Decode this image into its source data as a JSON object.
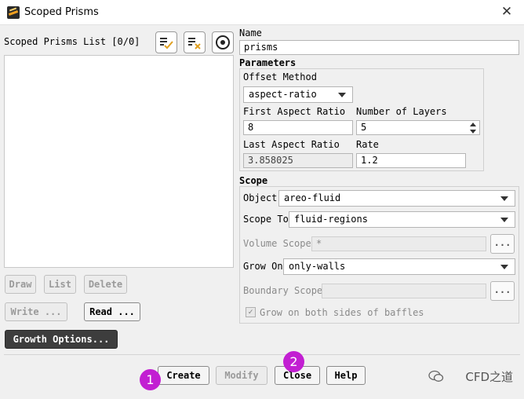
{
  "window": {
    "title": "Scoped Prisms"
  },
  "list": {
    "label": "Scoped Prisms List [0/0]",
    "items": []
  },
  "list_buttons": {
    "draw": "Draw",
    "list": "List",
    "delete": "Delete",
    "write": "Write ...",
    "read": "Read ...",
    "growth": "Growth Options..."
  },
  "name": {
    "label": "Name",
    "value": "prisms"
  },
  "parameters": {
    "heading": "Parameters",
    "offset_method_label": "Offset Method",
    "offset_method_value": "aspect-ratio",
    "first_aspect_label": "First Aspect Ratio",
    "first_aspect_value": "8",
    "layers_label": "Number of Layers",
    "layers_value": "5",
    "last_aspect_label": "Last Aspect Ratio",
    "last_aspect_value": "3.858025",
    "rate_label": "Rate",
    "rate_value": "1.2"
  },
  "scope": {
    "heading": "Scope",
    "object_label": "Object",
    "object_value": "areo-fluid",
    "scope_to_label": "Scope To",
    "scope_to_value": "fluid-regions",
    "volume_scope_label": "Volume Scope",
    "volume_scope_value": "*",
    "grow_on_label": "Grow On",
    "grow_on_value": "only-walls",
    "boundary_scope_label": "Boundary Scope",
    "boundary_scope_value": "",
    "baffles_label": "Grow on both sides of baffles",
    "baffles_checked": true,
    "dots": "..."
  },
  "footer": {
    "create": "Create",
    "modify": "Modify",
    "close": "Close",
    "help": "Help"
  },
  "annotations": {
    "badge1": "1",
    "badge2": "2",
    "watermark": "CFD之道"
  },
  "colors": {
    "badge": "#c21fd2",
    "dark_button": "#3d3d3d"
  }
}
